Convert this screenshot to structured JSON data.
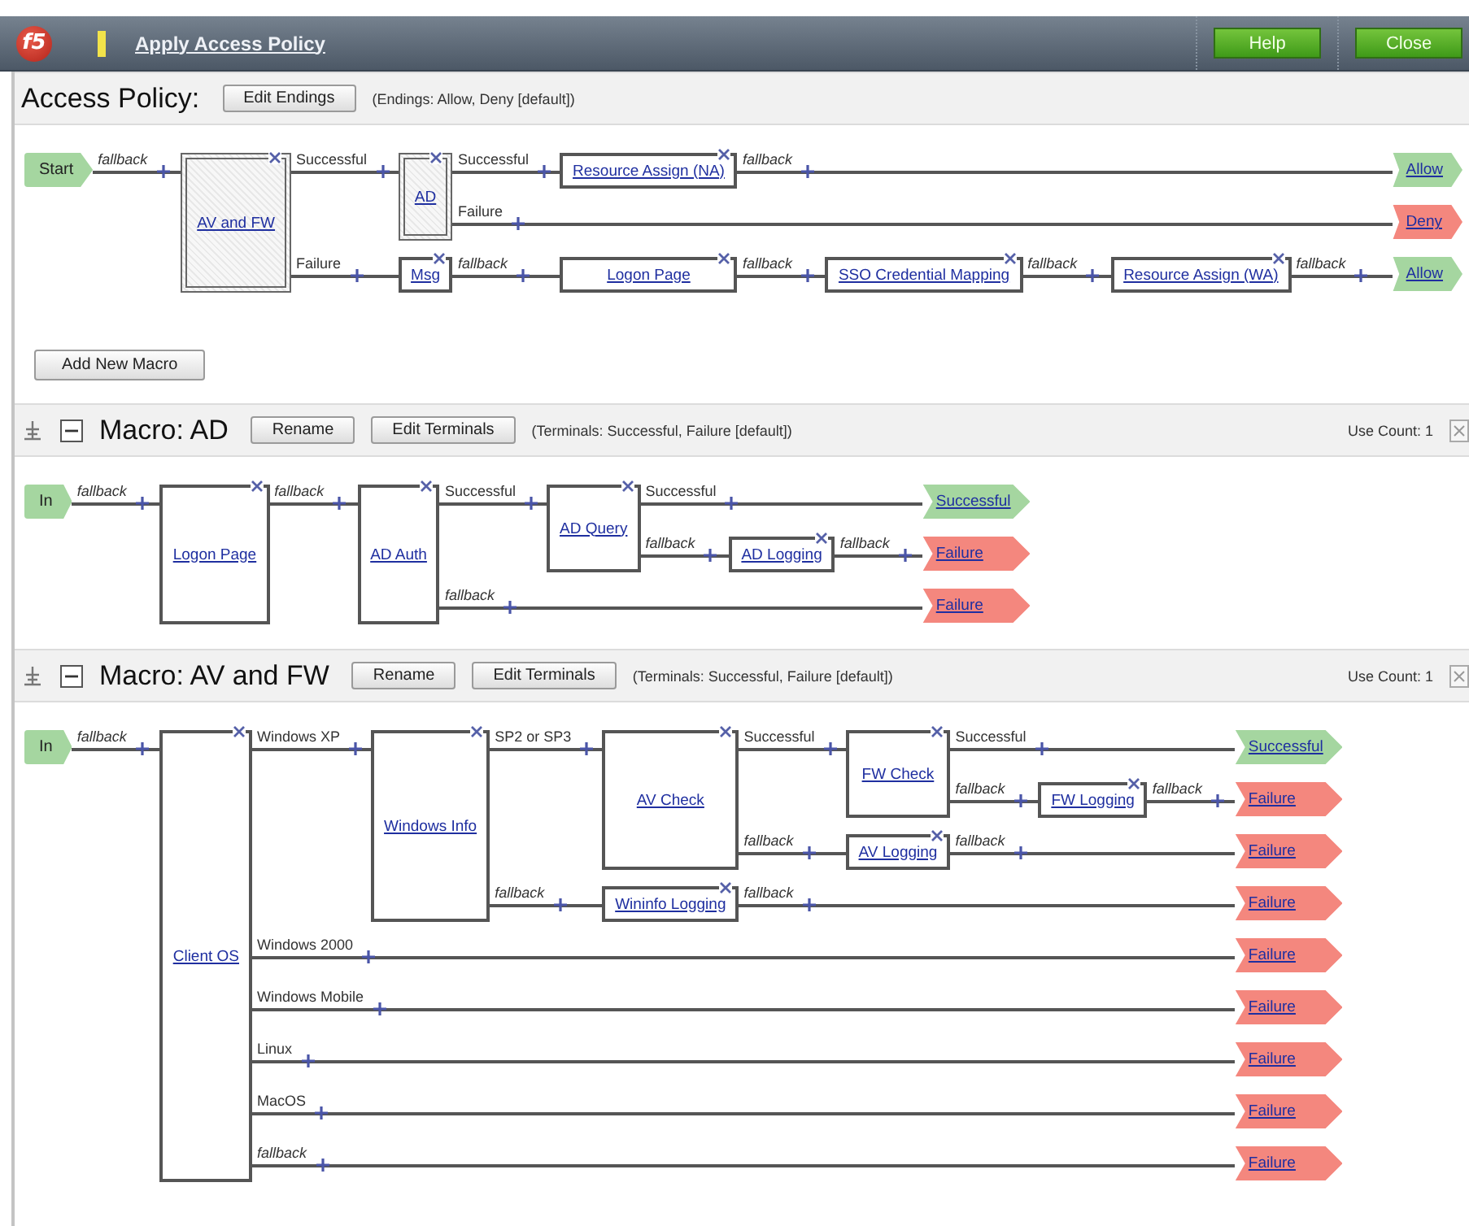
{
  "header": {
    "logo": "f5",
    "title": "Apply Access Policy",
    "buttons": [
      "Help",
      "Close"
    ]
  },
  "sections": [
    {
      "kind": "policy",
      "title": "Access Policy:",
      "buttons": [
        "Edit Endings"
      ],
      "note": "(Endings: Allow, Deny [default])",
      "flow": {
        "kind": "start",
        "label": "Start",
        "color": "#a5d6a0",
        "branches": [
          {
            "label": "fallback",
            "kind": "fallback",
            "to": {
              "kind": "macro",
              "label": "AV and FW",
              "branches": [
                {
                  "label": "Successful",
                  "kind": "rule",
                  "to": {
                    "kind": "macro",
                    "label": "AD",
                    "branches": [
                      {
                        "label": "Successful",
                        "kind": "rule",
                        "to": {
                          "kind": "action",
                          "label": "Resource Assign (NA)",
                          "branches": [
                            {
                              "label": "fallback",
                              "kind": "fallback",
                              "to": {
                                "kind": "ending",
                                "label": "Allow",
                                "color": "#a5d6a0"
                              }
                            }
                          ]
                        }
                      },
                      {
                        "label": "Failure",
                        "kind": "rule",
                        "to": {
                          "kind": "ending",
                          "label": "Deny",
                          "color": "#f4877e"
                        }
                      }
                    ]
                  }
                },
                {
                  "label": "Failure",
                  "kind": "rule",
                  "to": {
                    "kind": "action",
                    "label": "Msg",
                    "branches": [
                      {
                        "label": "fallback",
                        "kind": "fallback",
                        "to": {
                          "kind": "action",
                          "label": "Logon Page",
                          "branches": [
                            {
                              "label": "fallback",
                              "kind": "fallback",
                              "to": {
                                "kind": "action",
                                "label": "SSO Credential Mapping",
                                "branches": [
                                  {
                                    "label": "fallback",
                                    "kind": "fallback",
                                    "to": {
                                      "kind": "action",
                                      "label": "Resource Assign (WA)",
                                      "branches": [
                                        {
                                          "label": "fallback",
                                          "kind": "fallback",
                                          "to": {
                                            "kind": "ending",
                                            "label": "Allow",
                                            "color": "#a5d6a0"
                                          }
                                        }
                                      ]
                                    }
                                  }
                                ]
                              }
                            }
                          ]
                        }
                      }
                    ]
                  }
                }
              ]
            }
          }
        ]
      },
      "add_button": "Add New Macro"
    },
    {
      "kind": "macro",
      "expanded": true,
      "title": "Macro: AD",
      "buttons": [
        "Rename",
        "Edit Terminals"
      ],
      "note": "(Terminals: Successful, Failure [default])",
      "use_count": "Use Count: 1",
      "flow": {
        "kind": "start",
        "label": "In",
        "color": "#a5d6a0",
        "branches": [
          {
            "label": "fallback",
            "kind": "fallback",
            "to": {
              "kind": "action",
              "label": "Logon Page",
              "branches": [
                {
                  "label": "fallback",
                  "kind": "fallback",
                  "to": {
                    "kind": "action",
                    "label": "AD Auth",
                    "branches": [
                      {
                        "label": "Successful",
                        "kind": "rule",
                        "to": {
                          "kind": "action",
                          "label": "AD Query",
                          "branches": [
                            {
                              "label": "Successful",
                              "kind": "rule",
                              "to": {
                                "kind": "ending",
                                "label": "Successful",
                                "color": "#a5d6a0"
                              }
                            },
                            {
                              "label": "fallback",
                              "kind": "fallback",
                              "to": {
                                "kind": "action",
                                "label": "AD Logging",
                                "branches": [
                                  {
                                    "label": "fallback",
                                    "kind": "fallback",
                                    "to": {
                                      "kind": "ending",
                                      "label": "Failure",
                                      "color": "#f4877e"
                                    }
                                  }
                                ]
                              }
                            }
                          ]
                        }
                      },
                      {
                        "label": "fallback",
                        "kind": "fallback",
                        "to": {
                          "kind": "ending",
                          "label": "Failure",
                          "color": "#f4877e"
                        }
                      }
                    ]
                  }
                }
              ]
            }
          }
        ]
      }
    },
    {
      "kind": "macro",
      "expanded": true,
      "title": "Macro: AV and FW",
      "buttons": [
        "Rename",
        "Edit Terminals"
      ],
      "note": "(Terminals: Successful, Failure [default])",
      "use_count": "Use Count: 1",
      "flow": {
        "kind": "start",
        "label": "In",
        "color": "#a5d6a0",
        "branches": [
          {
            "label": "fallback",
            "kind": "fallback",
            "to": {
              "kind": "action",
              "label": "Client OS",
              "branches": [
                {
                  "label": "Windows XP",
                  "kind": "rule",
                  "to": {
                    "kind": "action",
                    "label": "Windows Info",
                    "branches": [
                      {
                        "label": "SP2 or SP3",
                        "kind": "rule",
                        "to": {
                          "kind": "action",
                          "label": "AV Check",
                          "branches": [
                            {
                              "label": "Successful",
                              "kind": "rule",
                              "to": {
                                "kind": "action",
                                "label": "FW Check",
                                "branches": [
                                  {
                                    "label": "Successful",
                                    "kind": "rule",
                                    "to": {
                                      "kind": "ending",
                                      "label": "Successful",
                                      "color": "#a5d6a0"
                                    }
                                  },
                                  {
                                    "label": "fallback",
                                    "kind": "fallback",
                                    "to": {
                                      "kind": "action",
                                      "label": "FW Logging",
                                      "branches": [
                                        {
                                          "label": "fallback",
                                          "kind": "fallback",
                                          "to": {
                                            "kind": "ending",
                                            "label": "Failure",
                                            "color": "#f4877e"
                                          }
                                        }
                                      ]
                                    }
                                  }
                                ]
                              }
                            },
                            {
                              "label": "fallback",
                              "kind": "fallback",
                              "to": {
                                "kind": "action",
                                "label": "AV Logging",
                                "branches": [
                                  {
                                    "label": "fallback",
                                    "kind": "fallback",
                                    "to": {
                                      "kind": "ending",
                                      "label": "Failure",
                                      "color": "#f4877e"
                                    }
                                  }
                                ]
                              }
                            }
                          ]
                        }
                      },
                      {
                        "label": "fallback",
                        "kind": "fallback",
                        "to": {
                          "kind": "action",
                          "label": "Wininfo Logging",
                          "branches": [
                            {
                              "label": "fallback",
                              "kind": "fallback",
                              "to": {
                                "kind": "ending",
                                "label": "Failure",
                                "color": "#f4877e"
                              }
                            }
                          ]
                        }
                      }
                    ]
                  }
                },
                {
                  "label": "Windows 2000",
                  "kind": "rule",
                  "to": {
                    "kind": "ending",
                    "label": "Failure",
                    "color": "#f4877e"
                  }
                },
                {
                  "label": "Windows Mobile",
                  "kind": "rule",
                  "to": {
                    "kind": "ending",
                    "label": "Failure",
                    "color": "#f4877e"
                  }
                },
                {
                  "label": "Linux",
                  "kind": "rule",
                  "to": {
                    "kind": "ending",
                    "label": "Failure",
                    "color": "#f4877e"
                  }
                },
                {
                  "label": "MacOS",
                  "kind": "rule",
                  "to": {
                    "kind": "ending",
                    "label": "Failure",
                    "color": "#f4877e"
                  }
                },
                {
                  "label": "fallback",
                  "kind": "fallback",
                  "to": {
                    "kind": "ending",
                    "label": "Failure",
                    "color": "#f4877e"
                  }
                }
              ]
            }
          }
        ]
      }
    }
  ]
}
